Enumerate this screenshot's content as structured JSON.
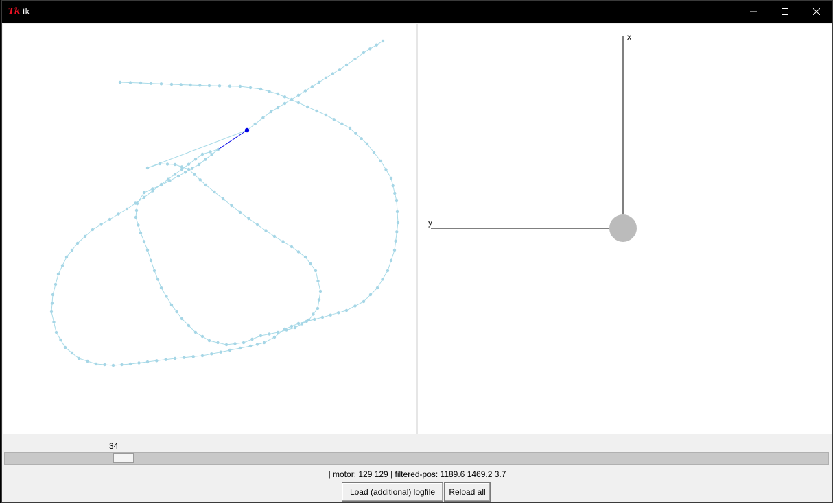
{
  "window": {
    "title": "tk",
    "icon": "tk-feather-icon"
  },
  "colors": {
    "path": "#a9dbe8",
    "path_point": "#a6d6e6",
    "current_marker": "#0000e6",
    "robot": "#bbbbbb",
    "axis": "#000000"
  },
  "right_canvas": {
    "x_axis_label": "x",
    "y_axis_label": "y"
  },
  "slider": {
    "value": "34",
    "fraction": 0.135
  },
  "status": "| motor: 129 129 | filtered-pos: 1189.6 1469.2 3.7",
  "buttons": {
    "load": "Load (additional) logfile",
    "reload": "Reload all"
  }
}
